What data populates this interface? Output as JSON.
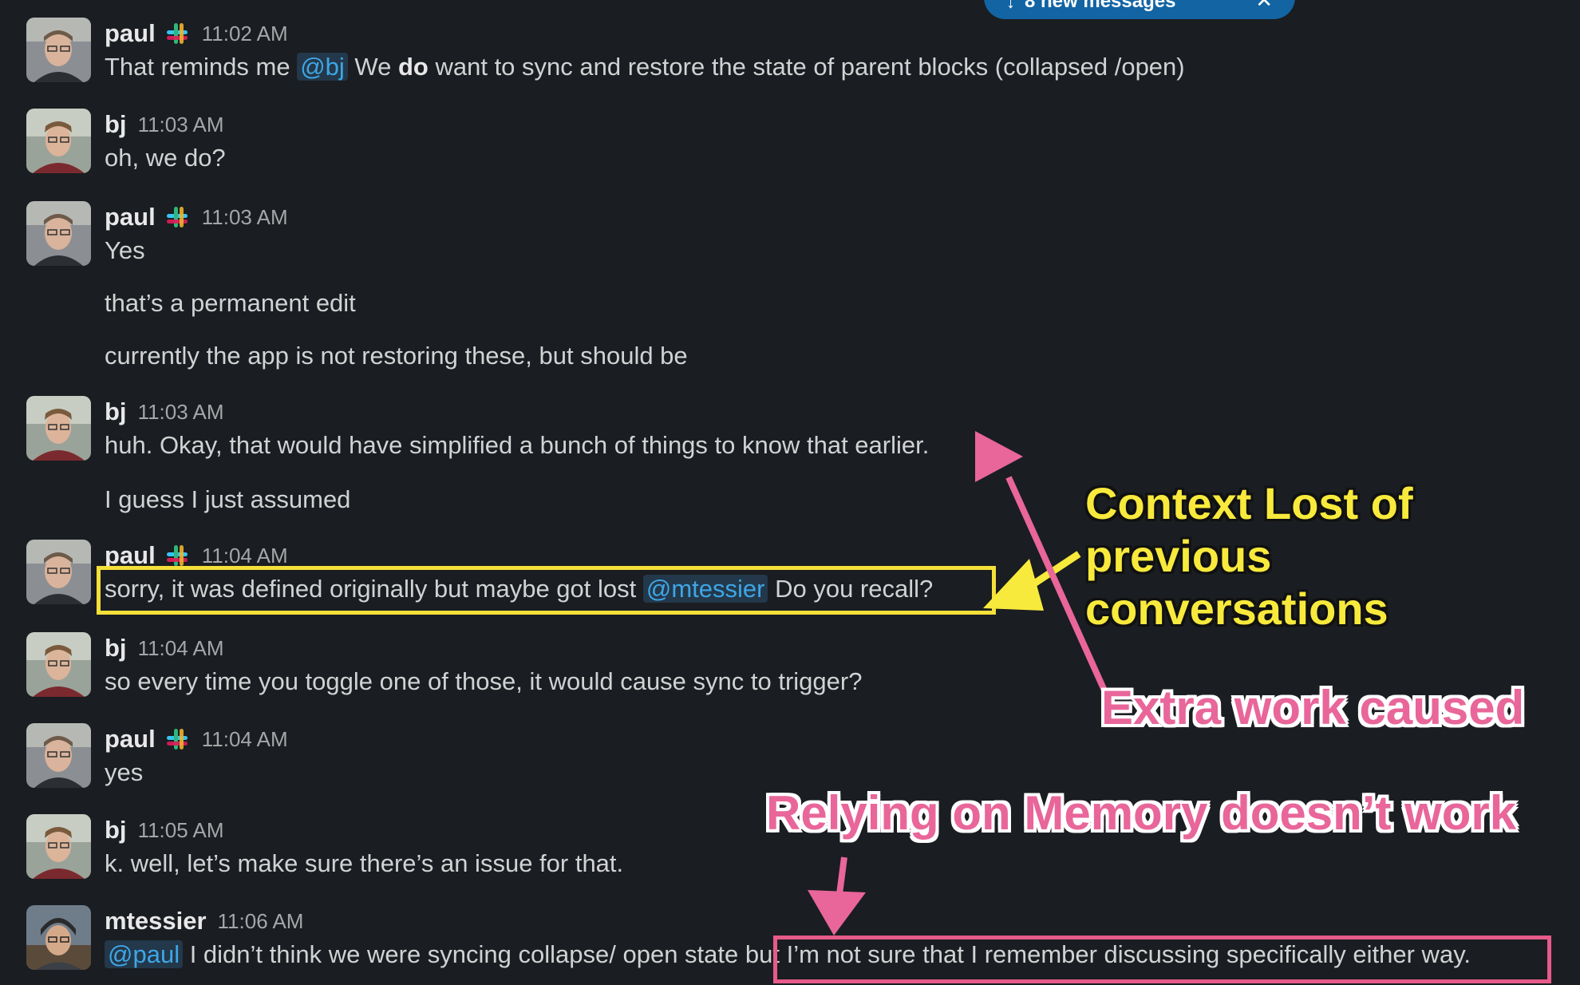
{
  "banner": {
    "label": "8 new messages",
    "icon": "arrow-down-icon",
    "close": "✕"
  },
  "messages": [
    {
      "author": "paul",
      "app_badge": true,
      "time": "11:02 AM",
      "parts": [
        {
          "t": "That reminds me "
        },
        {
          "t": "@bj",
          "mention": true
        },
        {
          "t": " We "
        },
        {
          "t": "do",
          "bold": true
        },
        {
          "t": " want to sync and restore the state of parent blocks (collapsed /open)"
        }
      ]
    },
    {
      "author": "bj",
      "time": "11:03 AM",
      "lines": [
        "oh, we do?"
      ]
    },
    {
      "author": "paul",
      "app_badge": true,
      "time": "11:03 AM",
      "lines": [
        "Yes",
        "that’s a permanent edit",
        "currently the app is not restoring these, but should be"
      ]
    },
    {
      "author": "bj",
      "time": "11:03 AM",
      "lines": [
        "huh. Okay, that would have simplified a bunch of things to know that earlier.",
        "I guess I just assumed"
      ]
    },
    {
      "author": "paul",
      "app_badge": true,
      "time": "11:04 AM",
      "parts": [
        {
          "t": "sorry, it was defined originally but maybe got lost "
        },
        {
          "t": "@mtessier",
          "mention": true
        },
        {
          "t": " Do you recall?"
        }
      ]
    },
    {
      "author": "bj",
      "time": "11:04 AM",
      "lines": [
        "so every time you toggle one of those, it would cause sync to trigger?"
      ]
    },
    {
      "author": "paul",
      "app_badge": true,
      "time": "11:04 AM",
      "lines": [
        "yes"
      ]
    },
    {
      "author": "bj",
      "time": "11:05 AM",
      "lines": [
        "k. well, let’s make sure there’s an issue for that."
      ]
    },
    {
      "author": "mtessier",
      "time": "11:06 AM",
      "parts": [
        {
          "t": "@paul",
          "mention": true
        },
        {
          "t": " I didn’t think we were syncing collapse/ open state "
        },
        {
          "t": "but I’m not sure that I remember discussing specifically either way."
        }
      ]
    }
  ],
  "annotations": {
    "context_lost": "Context Lost of\nprevious\nconversations",
    "extra_work": "Extra work caused",
    "memory": "Relying on Memory doesn’t work",
    "colors": {
      "yellow": "#f8ea3c",
      "pink": "#e8669a"
    }
  },
  "icons": {
    "app_badge": "slack-logo-icon",
    "avatar": "user-avatar"
  }
}
